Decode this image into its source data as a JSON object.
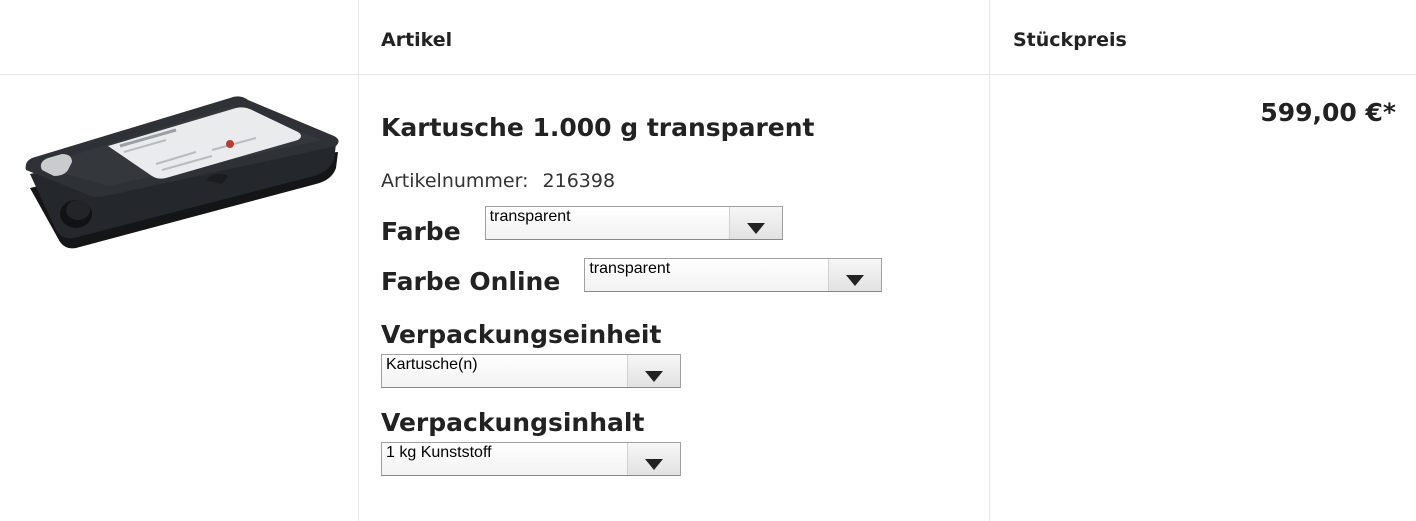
{
  "header": {
    "col_artikel": "Artikel",
    "col_preis": "Stückpreis"
  },
  "product": {
    "image_icon": "cartridge-product-image",
    "title": "Kartusche 1.000 g transparent",
    "artnr_label": "Artikelnummer:",
    "artnr_value": "216398",
    "price": "599,00 €*"
  },
  "options": {
    "farbe": {
      "label": "Farbe",
      "selected": "transparent"
    },
    "farbe_online": {
      "label": "Farbe Online",
      "selected": "transparent"
    },
    "verpackungseinheit": {
      "label": "Verpackungseinheit",
      "selected": "Kartusche(n)"
    },
    "verpackungsinhalt": {
      "label": "Verpackungsinhalt",
      "selected": "1 kg Kunststoff"
    }
  },
  "colors": {
    "border": "#e6e6e6",
    "text": "#222222",
    "cartridge_body": "#1d1f22",
    "label_sticker": "#e9ebec"
  }
}
